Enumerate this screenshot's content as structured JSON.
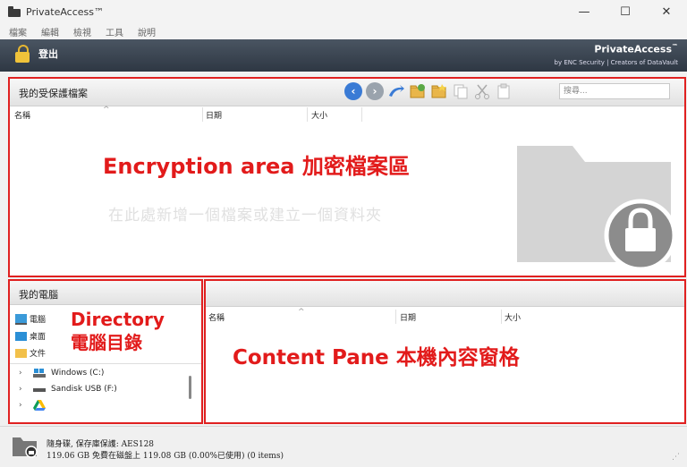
{
  "window": {
    "title": "PrivateAccess™",
    "minimize": "—",
    "maximize": "☐",
    "close": "✕"
  },
  "menu": [
    "檔案",
    "編輯",
    "檢視",
    "工具",
    "說明"
  ],
  "header": {
    "logout_label": "登出",
    "brand_name": "PrivateAccess",
    "brand_tm": "™",
    "brand_sub": "by ENC Security | Creators of DataVault"
  },
  "encryption": {
    "title": "我的受保護檔案",
    "search_placeholder": "搜尋...",
    "columns": [
      "名稱",
      "日期",
      "大小"
    ],
    "sort_indicator": "^",
    "empty_hint": "在此處新增一個檔案或建立一個資料夾",
    "annotation": "Encryption area  加密檔案區"
  },
  "directory": {
    "title": "我的電腦",
    "items": [
      {
        "label": "電腦",
        "icon": "computer-icon"
      },
      {
        "label": "桌面",
        "icon": "desktop-icon"
      },
      {
        "label": "文件",
        "icon": "folder-icon"
      }
    ],
    "drives": [
      {
        "label": "Windows (C:)",
        "icon": "windows-drive-icon"
      },
      {
        "label": "Sandisk USB (F:)",
        "icon": "usb-drive-icon"
      },
      {
        "label": "",
        "icon": "google-drive-icon"
      }
    ],
    "annotation_line1": "Directory",
    "annotation_line2": "電腦目錄"
  },
  "content": {
    "columns": [
      "名稱",
      "日期",
      "大小"
    ],
    "sort_indicator": "^",
    "annotation": "Content Pane  本機內容窗格"
  },
  "status": {
    "line1": "隨身碟, 保存庫保護: AES128",
    "line2": "119.06 GB 免費在磁盤上 119.08 GB (0.00%已使用) (0 items)"
  },
  "colors": {
    "annotation": "#e21b1b",
    "header_bg": "#3a4450",
    "outline": "#e02020"
  }
}
